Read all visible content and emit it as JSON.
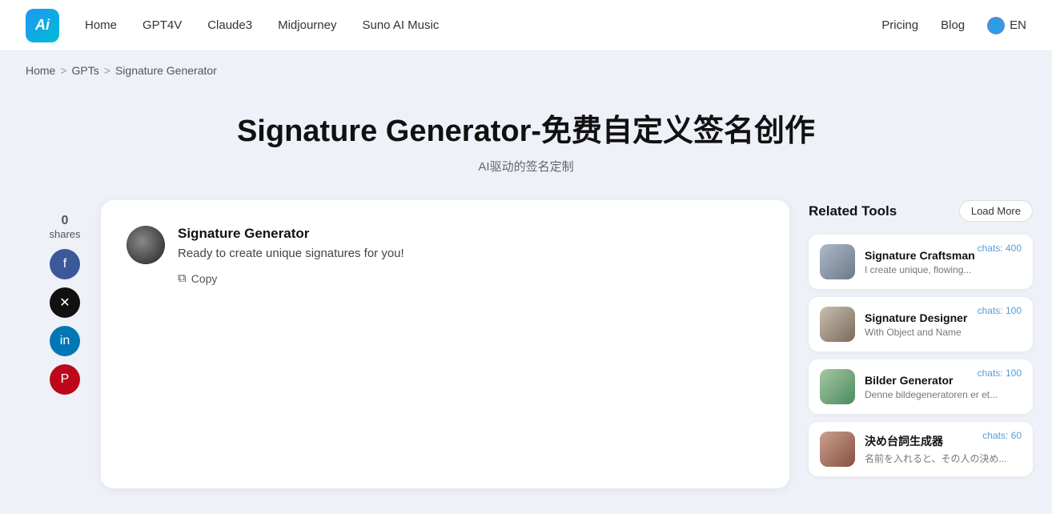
{
  "nav": {
    "logo_text": "Ai",
    "links": [
      {
        "label": "Home",
        "id": "home"
      },
      {
        "label": "GPT4V",
        "id": "gpt4v"
      },
      {
        "label": "Claude3",
        "id": "claude3"
      },
      {
        "label": "Midjourney",
        "id": "midjourney"
      },
      {
        "label": "Suno AI Music",
        "id": "suno"
      }
    ],
    "right_links": [
      {
        "label": "Pricing",
        "id": "pricing"
      },
      {
        "label": "Blog",
        "id": "blog"
      }
    ],
    "lang_label": "EN"
  },
  "breadcrumb": {
    "home": "Home",
    "sep1": ">",
    "gpts": "GPTs",
    "sep2": ">",
    "current": "Signature Generator"
  },
  "hero": {
    "title": "Signature Generator-免费自定义签名创作",
    "subtitle": "AI驱动的签名定制"
  },
  "share": {
    "count": "0",
    "label": "shares"
  },
  "chat": {
    "bot_name": "Signature Generator",
    "bot_message": "Ready to create unique signatures for you!",
    "copy_label": "Copy"
  },
  "related": {
    "title": "Related Tools",
    "load_more_label": "Load More",
    "tools": [
      {
        "name": "Signature Craftsman",
        "desc": "I create unique, flowing...",
        "chats": "chats: 400",
        "thumb_class": "thumb-sig-craftsman"
      },
      {
        "name": "Signature Designer",
        "desc": "With Object and Name",
        "chats": "chats: 100",
        "thumb_class": "thumb-sig-designer"
      },
      {
        "name": "Bilder Generator",
        "desc": "Denne bildegeneratoren er et...",
        "chats": "chats: 100",
        "thumb_class": "thumb-bilder"
      },
      {
        "name": "決め台詞生成器",
        "desc": "名前を入れると、その人の決め...",
        "chats": "chats: 60",
        "thumb_class": "thumb-ketai"
      }
    ]
  }
}
